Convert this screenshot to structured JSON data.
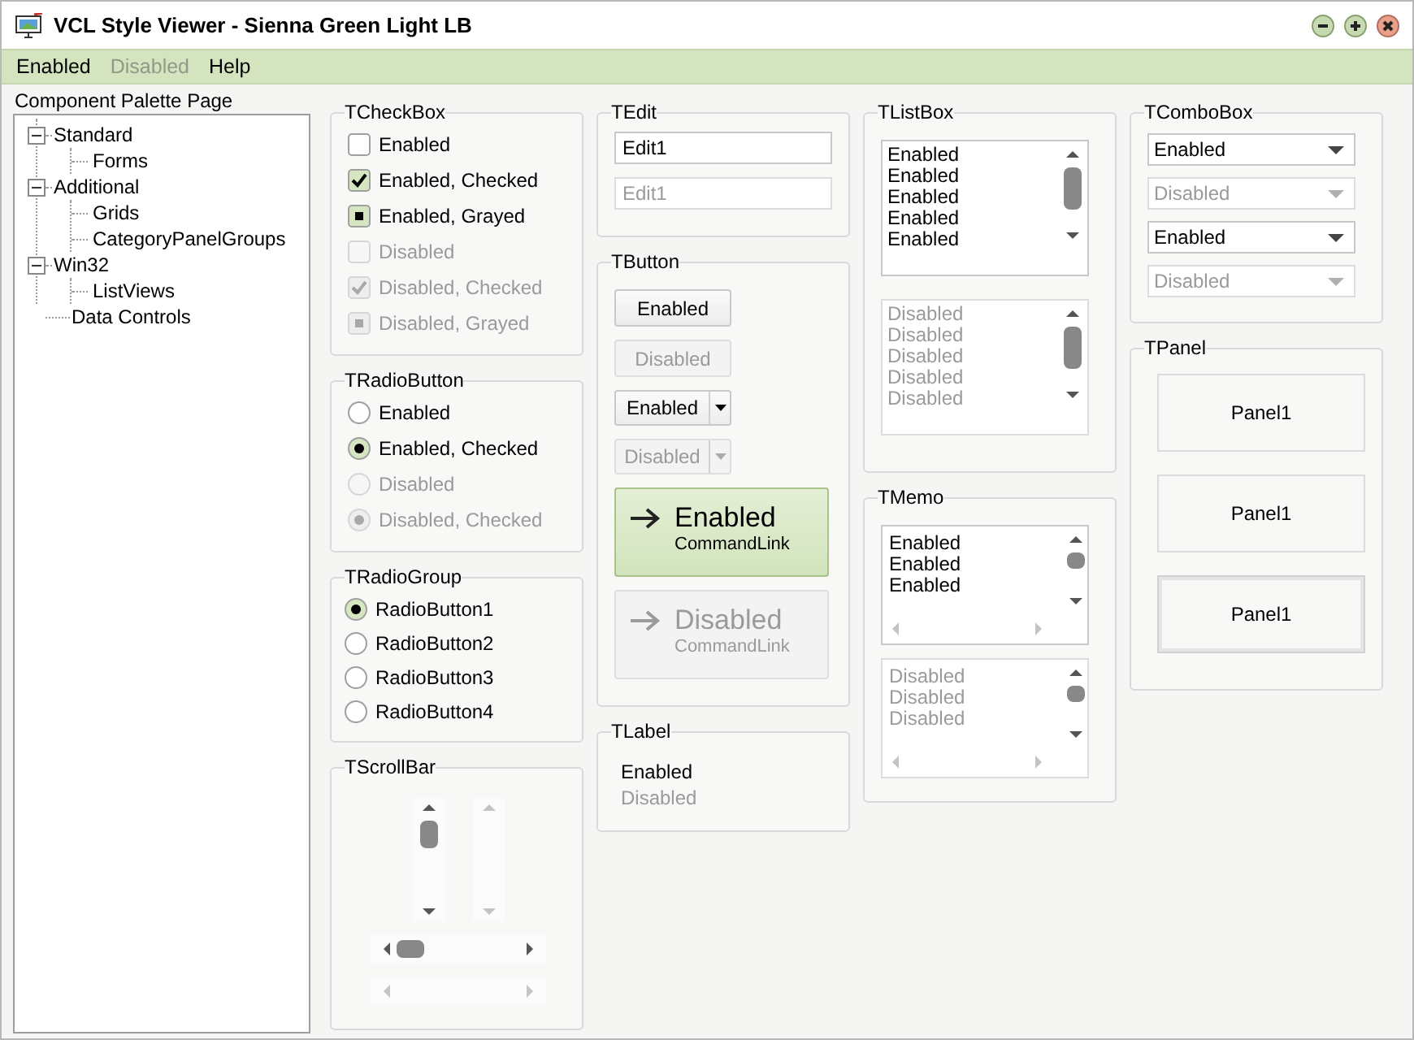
{
  "window": {
    "title": "VCL Style Viewer - Sienna Green Light LB"
  },
  "menu": [
    {
      "label": "Enabled",
      "disabled": false
    },
    {
      "label": "Disabled",
      "disabled": true
    },
    {
      "label": "Help",
      "disabled": false
    }
  ],
  "palette": {
    "label": "Component Palette Page",
    "tree": [
      {
        "label": "Standard",
        "expanded": true,
        "children": [
          {
            "label": "Forms"
          }
        ]
      },
      {
        "label": "Additional",
        "expanded": true,
        "children": [
          {
            "label": "Grids"
          },
          {
            "label": "CategoryPanelGroups"
          }
        ]
      },
      {
        "label": "Win32",
        "expanded": true,
        "children": [
          {
            "label": "ListViews"
          }
        ]
      },
      {
        "label": "Data Controls"
      }
    ]
  },
  "columns": [
    [
      {
        "kind": "checkbox",
        "title": "TCheckBox",
        "items": [
          {
            "label": "Enabled",
            "disabled": false,
            "checked": false,
            "grayed": false
          },
          {
            "label": "Enabled, Checked",
            "disabled": false,
            "checked": true,
            "grayed": false
          },
          {
            "label": "Enabled, Grayed",
            "disabled": false,
            "checked": false,
            "grayed": true
          },
          {
            "label": "Disabled",
            "disabled": true,
            "checked": false,
            "grayed": false
          },
          {
            "label": "Disabled, Checked",
            "disabled": true,
            "checked": true,
            "grayed": false
          },
          {
            "label": "Disabled, Grayed",
            "disabled": true,
            "checked": false,
            "grayed": true
          }
        ]
      },
      {
        "kind": "radio",
        "title": "TRadioButton",
        "items": [
          {
            "label": "Enabled",
            "disabled": false,
            "selected": false
          },
          {
            "label": "Enabled, Checked",
            "disabled": false,
            "selected": true
          },
          {
            "label": "Disabled",
            "disabled": true,
            "selected": false
          },
          {
            "label": "Disabled, Checked",
            "disabled": true,
            "selected": true
          }
        ]
      },
      {
        "kind": "radiogroup",
        "title": "TRadioGroup",
        "items": [
          {
            "label": "RadioButton1",
            "selected": true
          },
          {
            "label": "RadioButton2",
            "selected": false
          },
          {
            "label": "RadioButton3",
            "selected": false
          },
          {
            "label": "RadioButton4",
            "selected": false
          }
        ]
      },
      {
        "kind": "scrollbar",
        "title": "TScrollBar",
        "items": [
          {
            "kind": "vertical",
            "disabled": false
          },
          {
            "kind": "vertical",
            "disabled": true
          },
          {
            "kind": "horizontal",
            "disabled": false
          },
          {
            "kind": "horizontal",
            "disabled": true
          }
        ]
      }
    ],
    [
      {
        "kind": "edit",
        "title": "TEdit",
        "items": [
          {
            "value": "Edit1",
            "disabled": false
          },
          {
            "value": "Edit1",
            "disabled": true
          }
        ]
      },
      {
        "kind": "button",
        "title": "TButton",
        "items": [
          {
            "kind": "push",
            "label": "Enabled",
            "disabled": false
          },
          {
            "kind": "push",
            "label": "Disabled",
            "disabled": true
          },
          {
            "kind": "split",
            "label": "Enabled",
            "disabled": false
          },
          {
            "kind": "split",
            "label": "Disabled",
            "disabled": true
          },
          {
            "kind": "commandlink",
            "label": "Enabled",
            "note": "CommandLink",
            "disabled": false
          },
          {
            "kind": "commandlink",
            "label": "Disabled",
            "note": "CommandLink",
            "disabled": true
          }
        ]
      },
      {
        "kind": "label",
        "title": "TLabel",
        "items": [
          {
            "text": "Enabled",
            "disabled": false
          },
          {
            "text": "Disabled",
            "disabled": true
          }
        ]
      }
    ],
    [
      {
        "kind": "listbox",
        "title": "TListBox",
        "items": [
          {
            "disabled": false,
            "lines": [
              "Enabled",
              "Enabled",
              "Enabled",
              "Enabled",
              "Enabled"
            ]
          },
          {
            "disabled": true,
            "lines": [
              "Disabled",
              "Disabled",
              "Disabled",
              "Disabled",
              "Disabled"
            ]
          }
        ]
      },
      {
        "kind": "memo",
        "title": "TMemo",
        "items": [
          {
            "disabled": false,
            "lines": [
              "Enabled",
              "Enabled",
              "Enabled"
            ]
          },
          {
            "disabled": true,
            "lines": [
              "Disabled",
              "Disabled",
              "Disabled"
            ]
          }
        ]
      }
    ],
    [
      {
        "kind": "combobox",
        "title": "TComboBox",
        "items": [
          {
            "value": "Enabled",
            "disabled": false
          },
          {
            "value": "Disabled",
            "disabled": true
          },
          {
            "value": "Enabled",
            "disabled": false
          },
          {
            "value": "Disabled",
            "disabled": true
          }
        ]
      },
      {
        "kind": "panel",
        "title": "TPanel",
        "items": [
          {
            "label": "Panel1",
            "kind": "flat"
          },
          {
            "label": "Panel1",
            "kind": "flat"
          },
          {
            "label": "Panel1",
            "kind": "framed"
          }
        ]
      }
    ]
  ]
}
